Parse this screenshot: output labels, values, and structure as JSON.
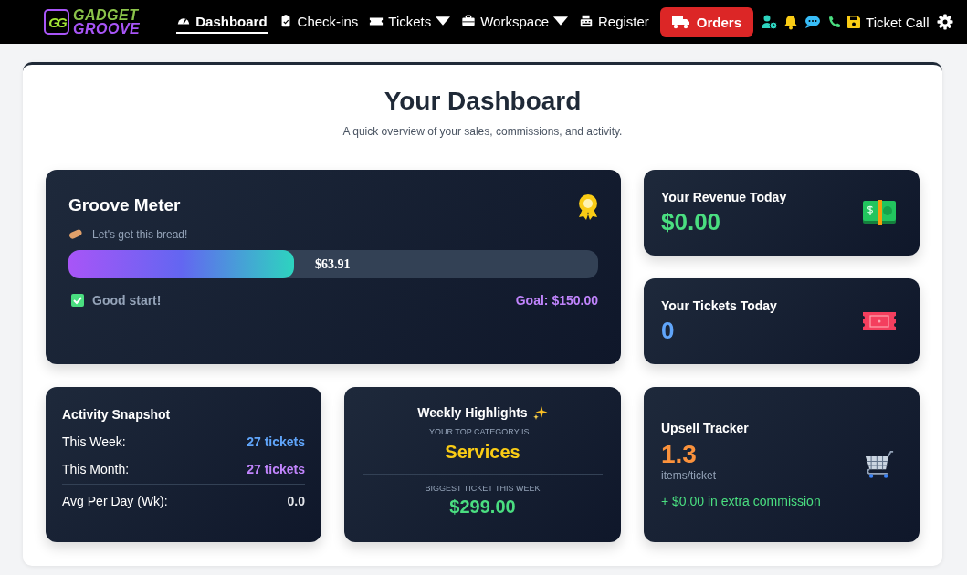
{
  "nav": {
    "logo": {
      "mark": "GG",
      "line1": "GADGET",
      "line2": "GROOVE"
    },
    "items": [
      {
        "label": "Dashboard",
        "dropdown": false,
        "selected": true
      },
      {
        "label": "Check-ins",
        "dropdown": false,
        "selected": false
      },
      {
        "label": "Tickets",
        "dropdown": true,
        "selected": false
      },
      {
        "label": "Workspace",
        "dropdown": true,
        "selected": false
      },
      {
        "label": "Register",
        "dropdown": false,
        "selected": false
      }
    ],
    "orders_button": "Orders",
    "ticket_call": "Ticket Call"
  },
  "header": {
    "title": "Your Dashboard",
    "subtitle": "A quick overview of your sales, commissions, and activity."
  },
  "groove_meter": {
    "title": "Groove Meter",
    "tagline": "Let's get this bread!",
    "amount": "$63.91",
    "level": 0.426,
    "status": "Good start!",
    "goal": "Goal: $150.00"
  },
  "revenue": {
    "title": "Your Revenue Today",
    "value": "$0.00"
  },
  "tickets": {
    "title": "Your Tickets Today",
    "value": "0"
  },
  "activity": {
    "title": "Activity Snapshot",
    "rows": [
      {
        "label": "This Week:",
        "value": "27 tickets",
        "color": "#60a5fa"
      },
      {
        "label": "This Month:",
        "value": "27 tickets",
        "color": "#c084fc"
      },
      {
        "label": "Avg Per Day (Wk):",
        "value": "0.0",
        "color": "#e5e7eb"
      }
    ]
  },
  "highlights": {
    "title": "Weekly Highlights",
    "category_label": "YOUR TOP CATEGORY IS...",
    "category": "Services",
    "biggest_label": "BIGGEST TICKET THIS WEEK",
    "biggest": "$299.00"
  },
  "upsell": {
    "title": "Upsell Tracker",
    "value": "1.3",
    "unit": "items/ticket",
    "commission": "+ $0.00 in extra commission"
  }
}
